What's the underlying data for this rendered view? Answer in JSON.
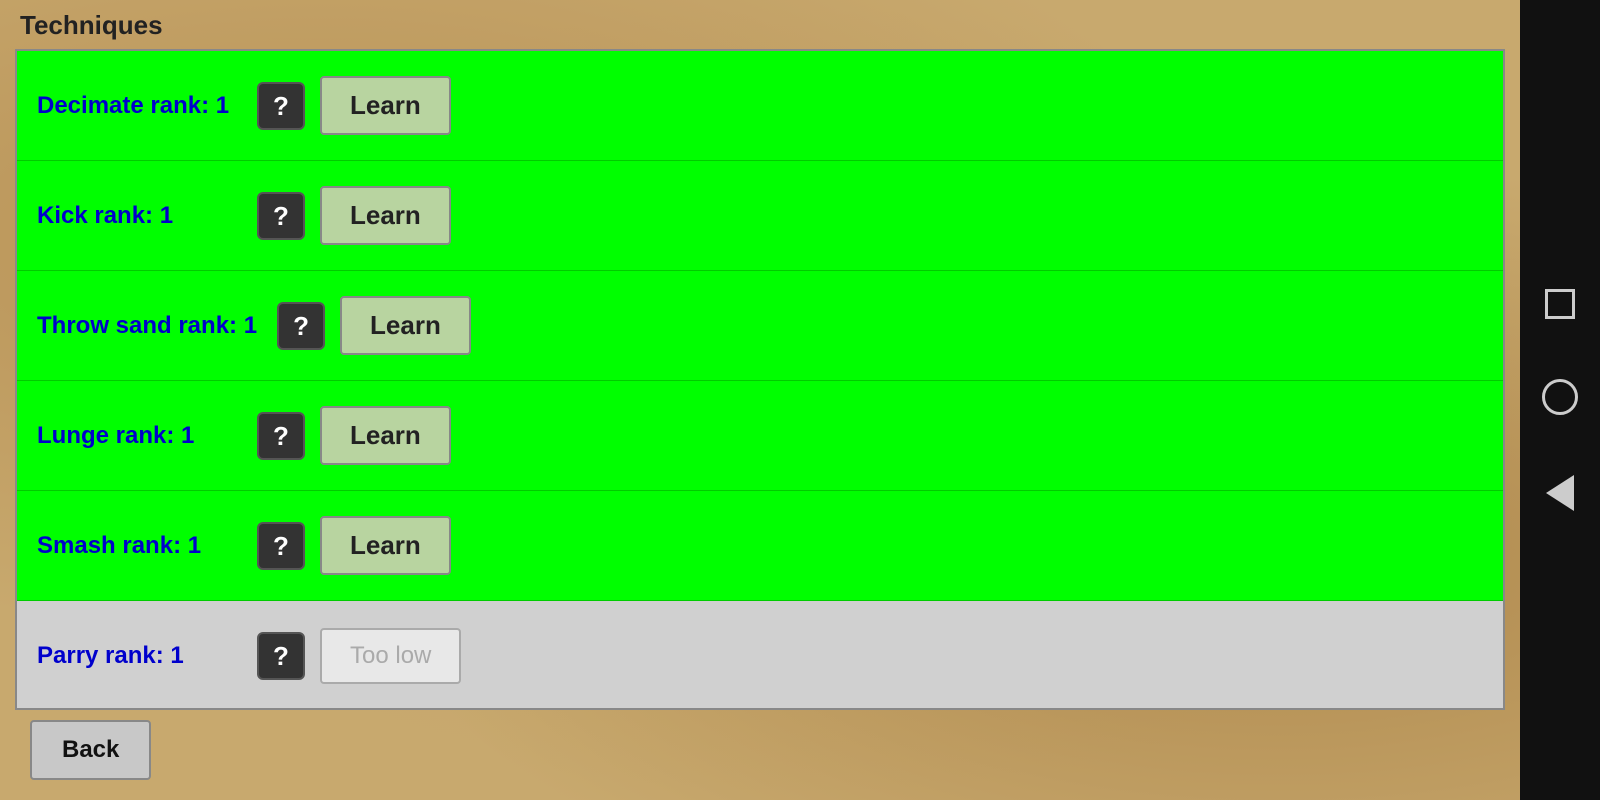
{
  "page": {
    "title": "Techniques"
  },
  "techniques": [
    {
      "id": "decimate",
      "name": "Decimate",
      "rank_label": "rank: 1",
      "status": "available",
      "btn_label": "Learn"
    },
    {
      "id": "kick",
      "name": "Kick",
      "rank_label": "rank: 1",
      "status": "available",
      "btn_label": "Learn"
    },
    {
      "id": "throw-sand",
      "name": "Throw sand",
      "rank_label": "rank: 1",
      "status": "available",
      "btn_label": "Learn"
    },
    {
      "id": "lunge",
      "name": "Lunge",
      "rank_label": "rank: 1",
      "status": "available",
      "btn_label": "Learn"
    },
    {
      "id": "smash",
      "name": "Smash",
      "rank_label": "rank: 1",
      "status": "available",
      "btn_label": "Learn"
    },
    {
      "id": "parry",
      "name": "Parry",
      "rank_label": "rank: 1",
      "status": "unavailable",
      "btn_label": "Too low"
    }
  ],
  "buttons": {
    "back_label": "Back",
    "info_symbol": "?",
    "learn_label": "Learn",
    "too_low_label": "Too low"
  }
}
